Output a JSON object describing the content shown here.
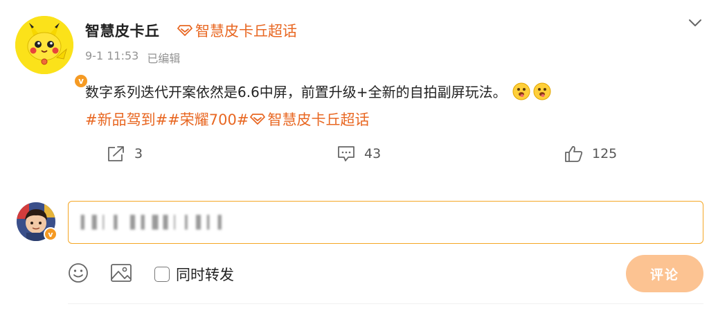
{
  "post": {
    "author_name": "智慧皮卡丘",
    "supertopic_label": "智慧皮卡丘超话",
    "timestamp": "9-1 11:53",
    "edited_label": "已编辑",
    "content_text": "数字系列迭代开案依然是6.6中屏，前置升级+全新的自拍副屏玩法。",
    "hashtags": "#新品驾到##荣耀700#",
    "hashtag_supertopic": "智慧皮卡丘超话",
    "verified_badge": "v",
    "actions": {
      "share_count": "3",
      "comment_count": "43",
      "like_count": "125"
    }
  },
  "composer": {
    "input_value": "▍▌▏▍ ▌▍▋▌▏▎▌▎▍",
    "sync_label": "同时转发",
    "submit_label": "评论",
    "verified_badge": "v"
  },
  "colors": {
    "accent": "#e86722",
    "input_border": "#f5a623",
    "submit_bg": "#fcc392",
    "badge": "#f59a23"
  },
  "icons": {
    "more": "chevron-down-icon",
    "supertopic": "diamond-icon",
    "share": "share-icon",
    "comment": "comment-icon",
    "like": "thumbs-up-icon",
    "emoji": "smiley-icon",
    "image": "image-icon"
  }
}
